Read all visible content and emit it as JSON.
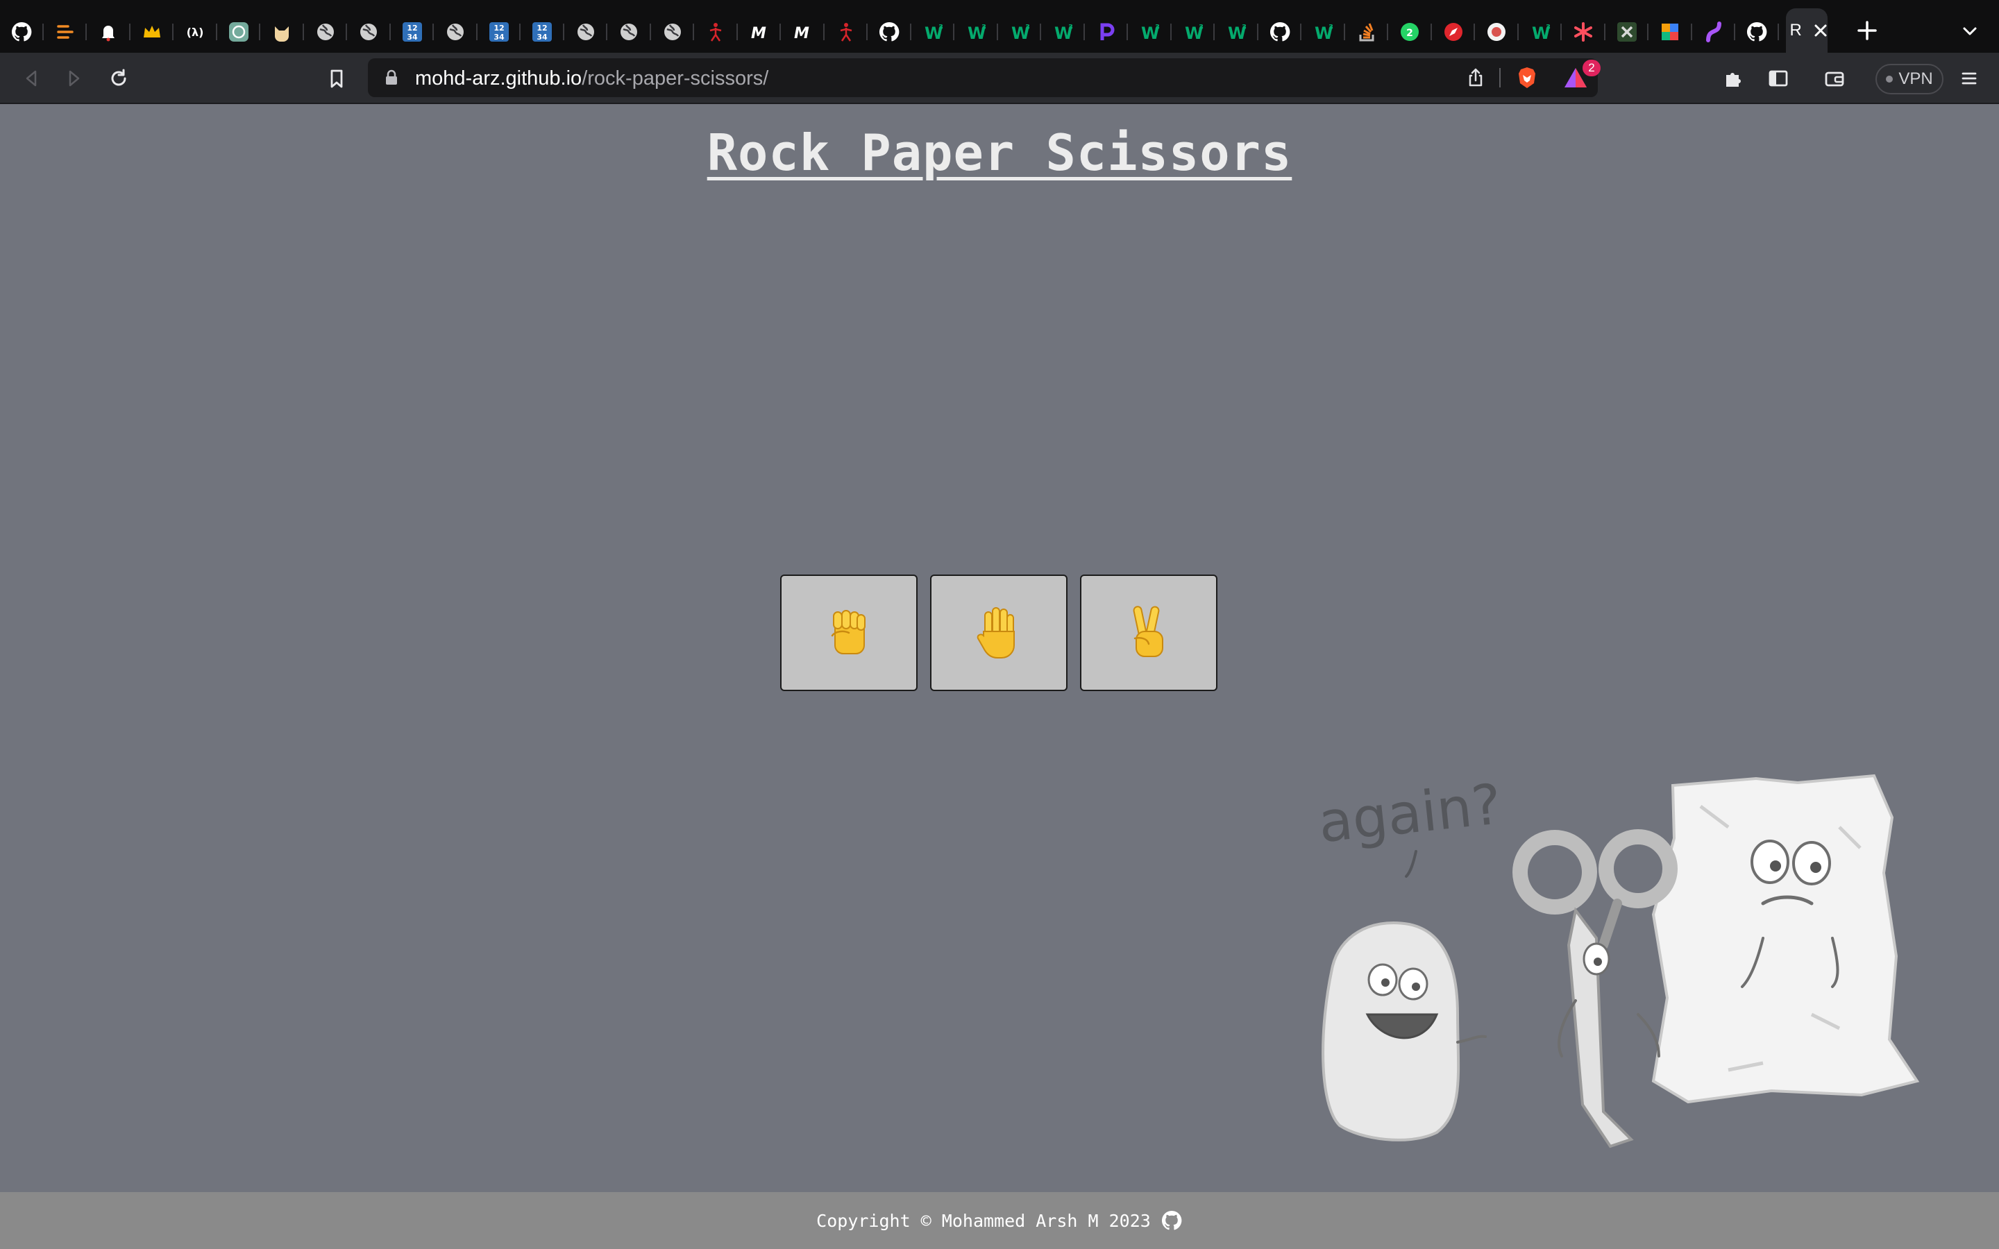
{
  "browser": {
    "tabs": [
      {
        "icon": "github-icon",
        "color": "#ffffff"
      },
      {
        "icon": "lines-arrow-icon",
        "color": "#f28b24"
      },
      {
        "icon": "bell-icon",
        "color": "#ffffff"
      },
      {
        "icon": "crown-icon",
        "color": "#f5b800"
      },
      {
        "icon": "lambda-brackets-icon",
        "color": "#ffffff"
      },
      {
        "icon": "openai-icon",
        "color": "#74aa9c"
      },
      {
        "icon": "cat-icon",
        "color": "#f0d4a0"
      },
      {
        "icon": "globe-icon",
        "color": "#cfcfcf"
      },
      {
        "icon": "globe-icon",
        "color": "#cfcfcf"
      },
      {
        "icon": "numbers-icon",
        "color": "#2f6fb8"
      },
      {
        "icon": "globe-icon",
        "color": "#cfcfcf"
      },
      {
        "icon": "numbers-icon",
        "color": "#2f6fb8"
      },
      {
        "icon": "numbers-icon",
        "color": "#2f6fb8"
      },
      {
        "icon": "globe-icon",
        "color": "#cfcfcf"
      },
      {
        "icon": "globe-icon",
        "color": "#cfcfcf"
      },
      {
        "icon": "globe-icon",
        "color": "#cfcfcf"
      },
      {
        "icon": "stick-figure-icon",
        "color": "#d6252b"
      },
      {
        "icon": "m-letter-icon",
        "color": "#ffffff"
      },
      {
        "icon": "m-letter-icon",
        "color": "#ffffff"
      },
      {
        "icon": "stick-figure-icon",
        "color": "#d6252b"
      },
      {
        "icon": "github-icon",
        "color": "#ffffff"
      },
      {
        "icon": "w3-icon",
        "color": "#04aa6d"
      },
      {
        "icon": "w3-icon",
        "color": "#04aa6d"
      },
      {
        "icon": "w3-icon",
        "color": "#04aa6d"
      },
      {
        "icon": "w3-icon",
        "color": "#04aa6d"
      },
      {
        "icon": "p-letter-icon",
        "color": "#7b3ff2"
      },
      {
        "icon": "w3-icon",
        "color": "#04aa6d"
      },
      {
        "icon": "w3-icon",
        "color": "#04aa6d"
      },
      {
        "icon": "w3-icon",
        "color": "#04aa6d"
      },
      {
        "icon": "github-icon",
        "color": "#ffffff"
      },
      {
        "icon": "w3-icon",
        "color": "#04aa6d"
      },
      {
        "icon": "stackoverflow-icon",
        "color": "#f48024"
      },
      {
        "icon": "whatsapp-icon",
        "color": "#25d366"
      },
      {
        "icon": "compass-icon",
        "color": "#e0262d"
      },
      {
        "icon": "shield-icon",
        "color": "#d9534f"
      },
      {
        "icon": "w3-icon",
        "color": "#04aa6d"
      },
      {
        "icon": "asterisk-icon",
        "color": "#ff4f5e"
      },
      {
        "icon": "tools-icon",
        "color": "#d9d9d9"
      },
      {
        "icon": "colorful-x-icon",
        "color": "#3b82f6"
      },
      {
        "icon": "swirl-icon",
        "color": "#a855f7"
      },
      {
        "icon": "github-icon",
        "color": "#ffffff"
      }
    ],
    "active_tab": {
      "title": "R",
      "icon": "letter-r"
    },
    "address": {
      "host": "mohd-arz.github.io",
      "path": "/rock-paper-scissors/"
    },
    "rewards_count": "2",
    "vpn_label": "VPN"
  },
  "page": {
    "title": "Rock Paper Scissors",
    "choices": [
      {
        "name": "rock",
        "icon": "raised-fist-icon"
      },
      {
        "name": "paper",
        "icon": "raised-hand-icon"
      },
      {
        "name": "scissors",
        "icon": "victory-hand-icon"
      }
    ],
    "illustration": {
      "caption": "again?",
      "characters": [
        "rock",
        "scissors",
        "paper"
      ]
    },
    "footer": {
      "text": "Copyright © Mohammed Arsh M 2023",
      "icon": "github-icon"
    }
  }
}
